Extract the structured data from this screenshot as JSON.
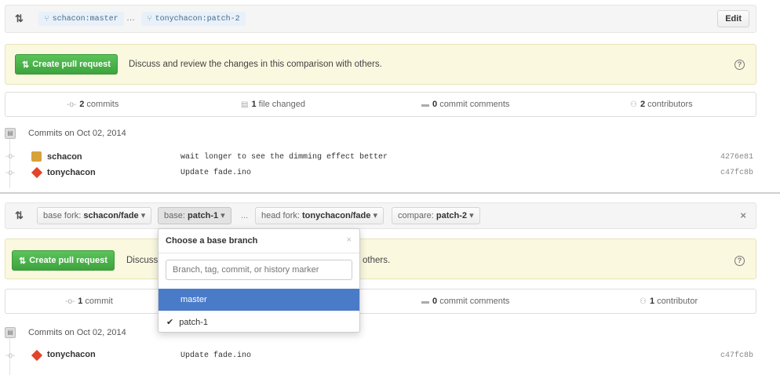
{
  "top": {
    "base_branch": "schacon:master",
    "ellipsis": "…",
    "head_branch": "tonychacon:patch-2",
    "edit_label": "Edit",
    "create_pr_label": "Create pull request",
    "banner_text": "Discuss and review the changes in this comparison with others.",
    "stats": {
      "commits_count": "2",
      "commits_label": "commits",
      "files_count": "1",
      "files_label": "file changed",
      "comments_count": "0",
      "comments_label": "commit comments",
      "contributors_count": "2",
      "contributors_label": "contributors"
    },
    "commits_date": "Commits on Oct 02, 2014",
    "commits": [
      {
        "author": "schacon",
        "message": "wait longer to see the dimming effect better",
        "sha": "4276e81"
      },
      {
        "author": "tonychacon",
        "message": "Update fade.ino",
        "sha": "c47fc8b"
      }
    ]
  },
  "bottom": {
    "base_fork_prefix": "base fork:",
    "base_fork_value": "schacon/fade",
    "base_prefix": "base:",
    "base_value": "patch-1",
    "ellipsis": "...",
    "head_fork_prefix": "head fork:",
    "head_fork_value": "tonychacon/fade",
    "compare_prefix": "compare:",
    "compare_value": "patch-2",
    "close_label": "×",
    "create_pr_label": "Create pull request",
    "banner_text_left": "Discuss",
    "banner_text_right": "others.",
    "stats": {
      "commits_count": "1",
      "commits_label": "commit",
      "comments_count": "0",
      "comments_label": "commit comments",
      "contributors_count": "1",
      "contributors_label": "contributor"
    },
    "commits_date": "Commits on Oct 02, 2014",
    "commits": [
      {
        "author": "tonychacon",
        "message": "Update fade.ino",
        "sha": "c47fc8b"
      }
    ]
  },
  "dropdown": {
    "title": "Choose a base branch",
    "close": "×",
    "placeholder": "Branch, tag, commit, or history marker",
    "items": [
      {
        "label": "master",
        "selected": true
      },
      {
        "label": "patch-1",
        "checked": true
      }
    ],
    "checkmark": "✔"
  },
  "icons": {
    "compare": "pull-request-icon",
    "branch": "branch-icon",
    "commit": "commit-icon",
    "file": "file-icon",
    "comment": "comment-icon",
    "contributors": "contributors-icon",
    "help": "help-icon"
  },
  "colors": {
    "green_button": "#3ea33e",
    "banner_bg": "#fbf8e0",
    "selected_item": "#4a7bc8",
    "branch_chip_bg": "#e8f1fa"
  }
}
